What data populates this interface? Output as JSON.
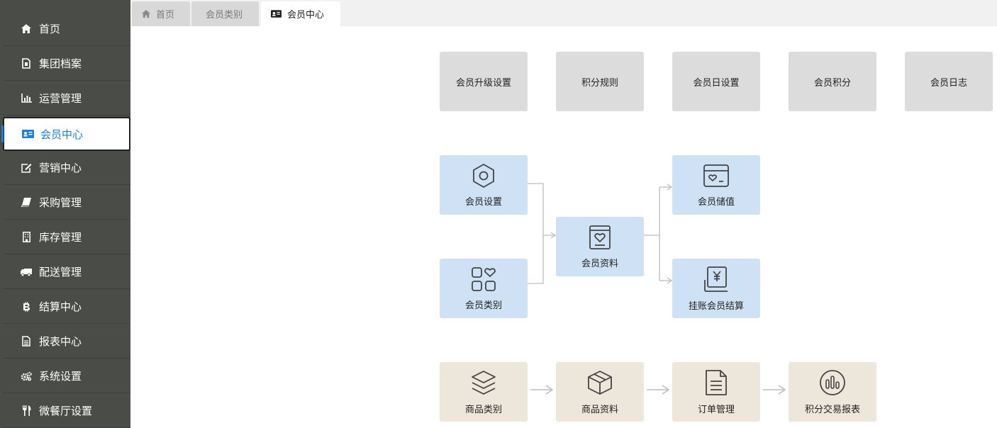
{
  "sidebar": {
    "items": [
      {
        "label": "首页",
        "icon": "home-icon"
      },
      {
        "label": "集团档案",
        "icon": "file-icon"
      },
      {
        "label": "运营管理",
        "icon": "bar-chart-icon"
      },
      {
        "label": "会员中心",
        "icon": "member-card-icon",
        "active": true
      },
      {
        "label": "营销中心",
        "icon": "edit-icon"
      },
      {
        "label": "采购管理",
        "icon": "book-icon"
      },
      {
        "label": "库存管理",
        "icon": "building-icon"
      },
      {
        "label": "配送管理",
        "icon": "truck-icon"
      },
      {
        "label": "结算中心",
        "icon": "bitcoin-icon"
      },
      {
        "label": "报表中心",
        "icon": "report-icon"
      },
      {
        "label": "系统设置",
        "icon": "gears-icon"
      },
      {
        "label": "微餐厅设置",
        "icon": "cutlery-icon"
      }
    ]
  },
  "tabs": [
    {
      "label": "首页",
      "icon": "home-icon"
    },
    {
      "label": "会员类别"
    },
    {
      "label": "会员中心",
      "icon": "member-card-icon",
      "active": true
    }
  ],
  "top_row": [
    "会员升级设置",
    "积分规则",
    "会员日设置",
    "会员积分",
    "会员日志"
  ],
  "flow": {
    "member_settings": "会员设置",
    "member_category": "会员类别",
    "member_profile": "会员资料",
    "member_recharge": "会员储值",
    "credit_settlement": "挂账会员结算"
  },
  "bottom_row": [
    "商品类别",
    "商品资料",
    "订单管理",
    "积分交易报表"
  ],
  "colors": {
    "sidebar_bg": "#4a4c48",
    "active_blue": "#1e7fd6",
    "gray_box": "#dcdcdc",
    "blue_box": "#cfe2f5",
    "beige_box": "#ede6da"
  }
}
